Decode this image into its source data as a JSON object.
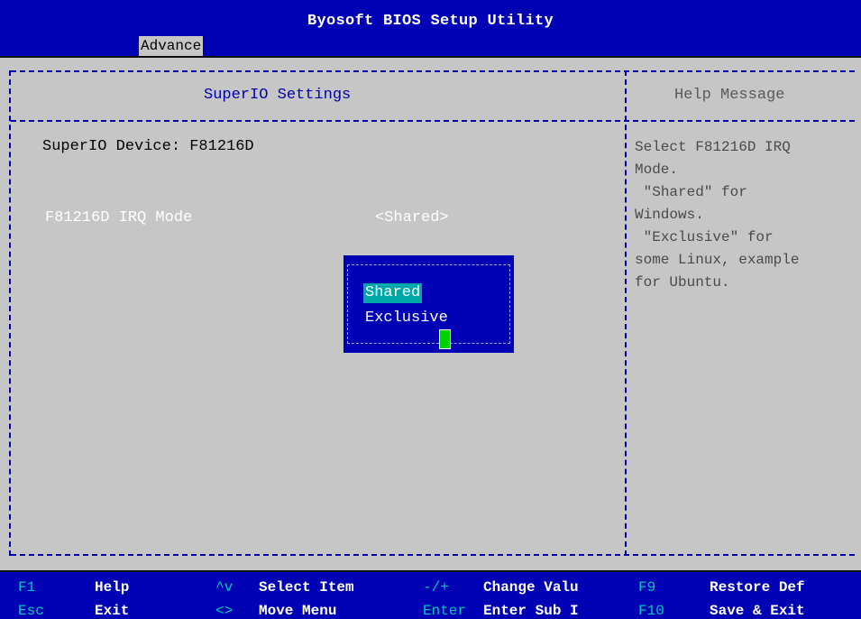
{
  "header": {
    "title": "Byosoft BIOS Setup Utility",
    "active_tab": "Advance"
  },
  "main": {
    "section_title": "SuperIO Settings",
    "device_label": "SuperIO Device: F81216D",
    "irq_mode_label": "F81216D IRQ Mode",
    "irq_mode_value": "<Shared>"
  },
  "help": {
    "title": "Help Message",
    "text": "Select F81216D IRQ\nMode.\n \"Shared\" for\nWindows.\n \"Exclusive\" for\nsome Linux, example\nfor Ubuntu."
  },
  "popup": {
    "options": [
      "Shared",
      "Exclusive"
    ],
    "selected": "Shared"
  },
  "footer": {
    "row1": [
      {
        "key": "F1",
        "desc": "Help"
      },
      {
        "key": "^v",
        "desc": "Select Item"
      },
      {
        "key": "-/+",
        "desc": "Change Valu"
      },
      {
        "key": "F9",
        "desc": "Restore Def"
      }
    ],
    "row2": [
      {
        "key": "Esc",
        "desc": "Exit"
      },
      {
        "key": "<>",
        "desc": "Move Menu"
      },
      {
        "key": "Enter",
        "desc": "Enter Sub I"
      },
      {
        "key": "F10",
        "desc": "Save & Exit"
      }
    ]
  },
  "colors": {
    "bar_blue": "#0000b4",
    "panel_gray": "#c6c6c6",
    "key_cyan": "#00c8b4",
    "highlight_teal": "#00a8a8",
    "cursor_green": "#00d200"
  }
}
